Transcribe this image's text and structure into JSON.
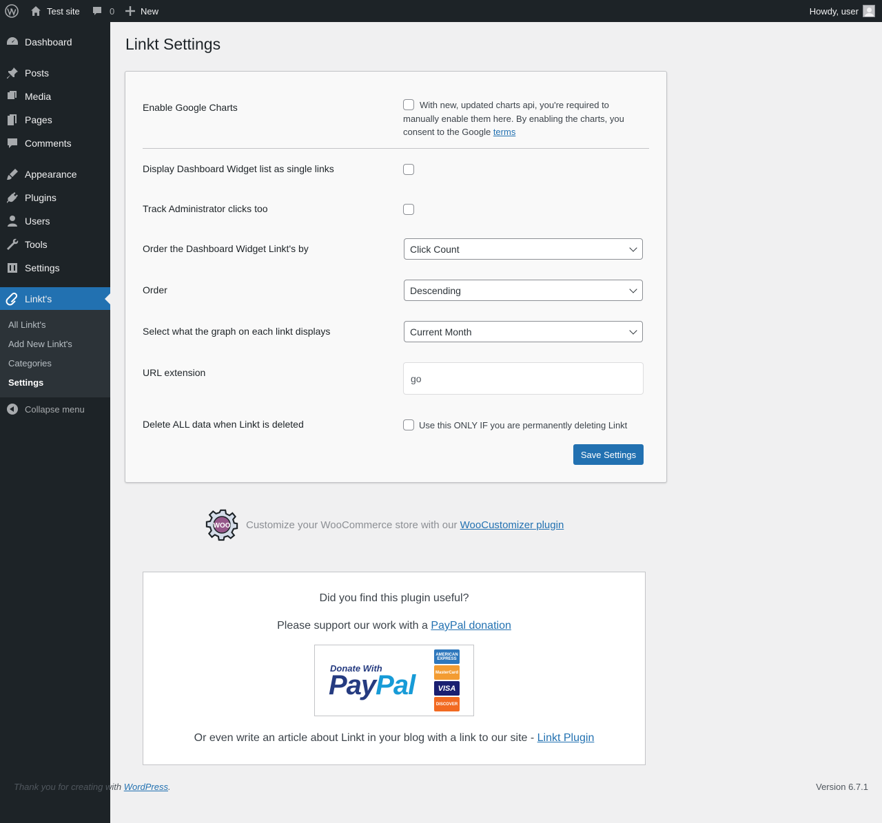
{
  "adminbar": {
    "site_name": "Test site",
    "comments_count": "0",
    "new_label": "New",
    "howdy": "Howdy, user"
  },
  "sidebar": {
    "items": [
      {
        "label": "Dashboard",
        "icon": "dashboard-icon"
      },
      {
        "label": "Posts",
        "icon": "pushpin-icon"
      },
      {
        "label": "Media",
        "icon": "media-icon"
      },
      {
        "label": "Pages",
        "icon": "pages-icon"
      },
      {
        "label": "Comments",
        "icon": "comment-icon"
      },
      {
        "label": "Appearance",
        "icon": "brush-icon"
      },
      {
        "label": "Plugins",
        "icon": "plug-icon"
      },
      {
        "label": "Users",
        "icon": "user-icon"
      },
      {
        "label": "Tools",
        "icon": "wrench-icon"
      },
      {
        "label": "Settings",
        "icon": "settings-icon"
      },
      {
        "label": "Linkt's",
        "icon": "paperclip-icon"
      }
    ],
    "submenu": [
      "All Linkt's",
      "Add New Linkt's",
      "Categories",
      "Settings"
    ],
    "collapse_label": "Collapse menu"
  },
  "page": {
    "title": "Linkt Settings"
  },
  "settings": {
    "google_charts_label": "Enable Google Charts",
    "google_charts_help": "With new, updated charts api, you're required to manually enable them here. By enabling the charts, you consent to the Google ",
    "google_charts_terms": "terms",
    "single_links_label": "Display Dashboard Widget list as single links",
    "track_admin_label": "Track Administrator clicks too",
    "order_by_label": "Order the Dashboard Widget Linkt's by",
    "order_by_value": "Click Count",
    "order_label": "Order",
    "order_value": "Descending",
    "graph_label": "Select what the graph on each linkt displays",
    "graph_value": "Current Month",
    "url_ext_label": "URL extension",
    "url_ext_value": "go",
    "delete_label": "Delete ALL data when Linkt is deleted",
    "delete_help": "Use this ONLY IF you are permanently deleting Linkt",
    "save_label": "Save Settings"
  },
  "woo": {
    "badge_text": "WOO",
    "text": "Customize your WooCommerce store with our ",
    "link": "WooCustomizer plugin"
  },
  "donate": {
    "question": "Did you find this plugin useful?",
    "support_text": "Please support our work with a ",
    "support_link": "PayPal donation",
    "donate_with": "Donate With",
    "paypal_pay": "Pay",
    "paypal_pal": "Pal",
    "cards": [
      "AMERICAN EXPRESS",
      "MasterCard",
      "VISA",
      "DISCOVER"
    ],
    "article_text": "Or even write an article about Linkt in your blog with a link to our site - ",
    "article_link": "Linkt Plugin"
  },
  "footer": {
    "thanks": "Thank you for creating with ",
    "wp_link": "WordPress",
    "period": ".",
    "version": "Version 6.7.1"
  }
}
